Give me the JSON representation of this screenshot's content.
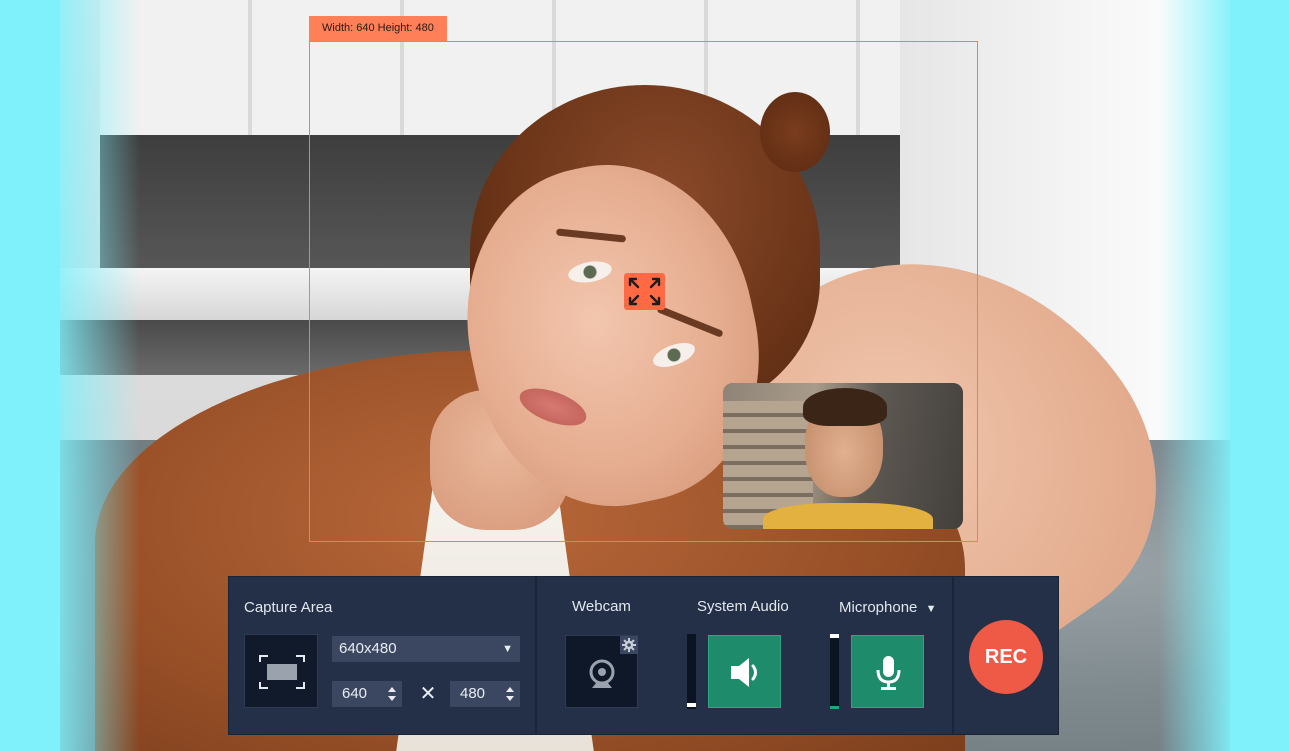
{
  "capture_frame": {
    "size_label": "Width: 640 Height: 480"
  },
  "panel": {
    "capture_area": {
      "label": "Capture Area",
      "resolution_value": "640x480",
      "width_value": "640",
      "height_value": "480",
      "times_sign": "✕"
    },
    "webcam": {
      "label": "Webcam"
    },
    "system_audio": {
      "label": "System Audio",
      "level": 0.0
    },
    "microphone": {
      "label": "Microphone",
      "dropdown_caret": "▼",
      "level": 0.04
    },
    "rec": {
      "label": "REC"
    }
  },
  "colors": {
    "accent_orange": "#ff7f59",
    "panel_bg": "#233048",
    "audio_green": "#1e8b6a",
    "rec_red": "#ee5a46",
    "backdrop_cyan": "#7ff1fb"
  },
  "icons": {
    "move_handle": "expand-arrows-icon",
    "capture_area": "screen-region-icon",
    "webcam": "webcam-icon",
    "webcam_settings": "gear-icon",
    "system_audio": "speaker-icon",
    "microphone": "microphone-icon"
  }
}
